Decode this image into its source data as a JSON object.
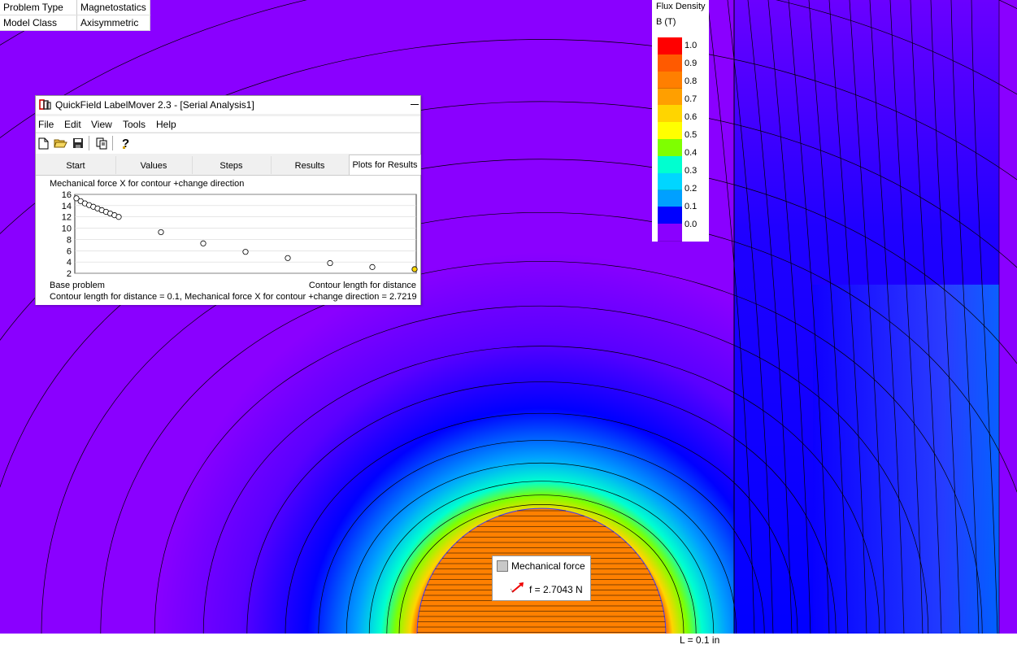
{
  "info": {
    "rows": [
      {
        "key": "Problem Type",
        "value": "Magnetostatics"
      },
      {
        "key": "Model Class",
        "value": "Axisymmetric"
      }
    ]
  },
  "legend": {
    "title": "Flux Density",
    "unit": "B (T)",
    "ticks": [
      "1.0",
      "0.9",
      "0.8",
      "0.7",
      "0.6",
      "0.5",
      "0.4",
      "0.3",
      "0.2",
      "0.1",
      "0.0"
    ],
    "colors": [
      "#ff0000",
      "#ff5a00",
      "#ff7f00",
      "#ff9f00",
      "#ffd500",
      "#ffff00",
      "#7fff00",
      "#00ffd0",
      "#00d6ff",
      "#00a0ff",
      "#0000ff",
      "#8a00ff"
    ]
  },
  "window": {
    "title": "QuickField LabelMover 2.3 - [Serial Analysis1]",
    "menu": [
      "File",
      "Edit",
      "View",
      "Tools",
      "Help"
    ],
    "toolbar": [
      "new-icon",
      "open-icon",
      "save-icon",
      "copy-icon",
      "help-icon"
    ],
    "tabs": [
      "Start",
      "Values",
      "Steps",
      "Results",
      "Plots for Results"
    ],
    "active_tab": "Plots for Results",
    "plot_title": "Mechanical force X for contour +change direction",
    "x_label_left": "Base problem",
    "x_label_right": "Contour length for distance",
    "status": "Contour length for distance = 0.1, Mechanical force X for contour +change direction = 2.7219"
  },
  "chart_data": {
    "type": "scatter",
    "y_ticks": [
      "16",
      "14",
      "12",
      "10",
      "8",
      "6",
      "4",
      "2"
    ],
    "ylim": [
      2,
      16
    ],
    "xlim": [
      0,
      20
    ],
    "x": [
      0,
      0.5,
      1,
      1.5,
      2,
      2.5,
      3,
      3.5,
      4,
      4.5,
      5,
      10,
      15,
      20,
      25,
      30,
      35,
      40
    ],
    "y": [
      15.3,
      14.8,
      14.4,
      14.1,
      13.8,
      13.5,
      13.2,
      12.9,
      12.6,
      12.3,
      12.0,
      9.3,
      7.3,
      5.8,
      4.7,
      3.8,
      3.1,
      2.72
    ],
    "highlight_color": "#ffd700"
  },
  "force": {
    "label": "Mechanical force",
    "value": "f = 2.7043 N"
  },
  "scale": {
    "label": "L = 0.1 in"
  }
}
